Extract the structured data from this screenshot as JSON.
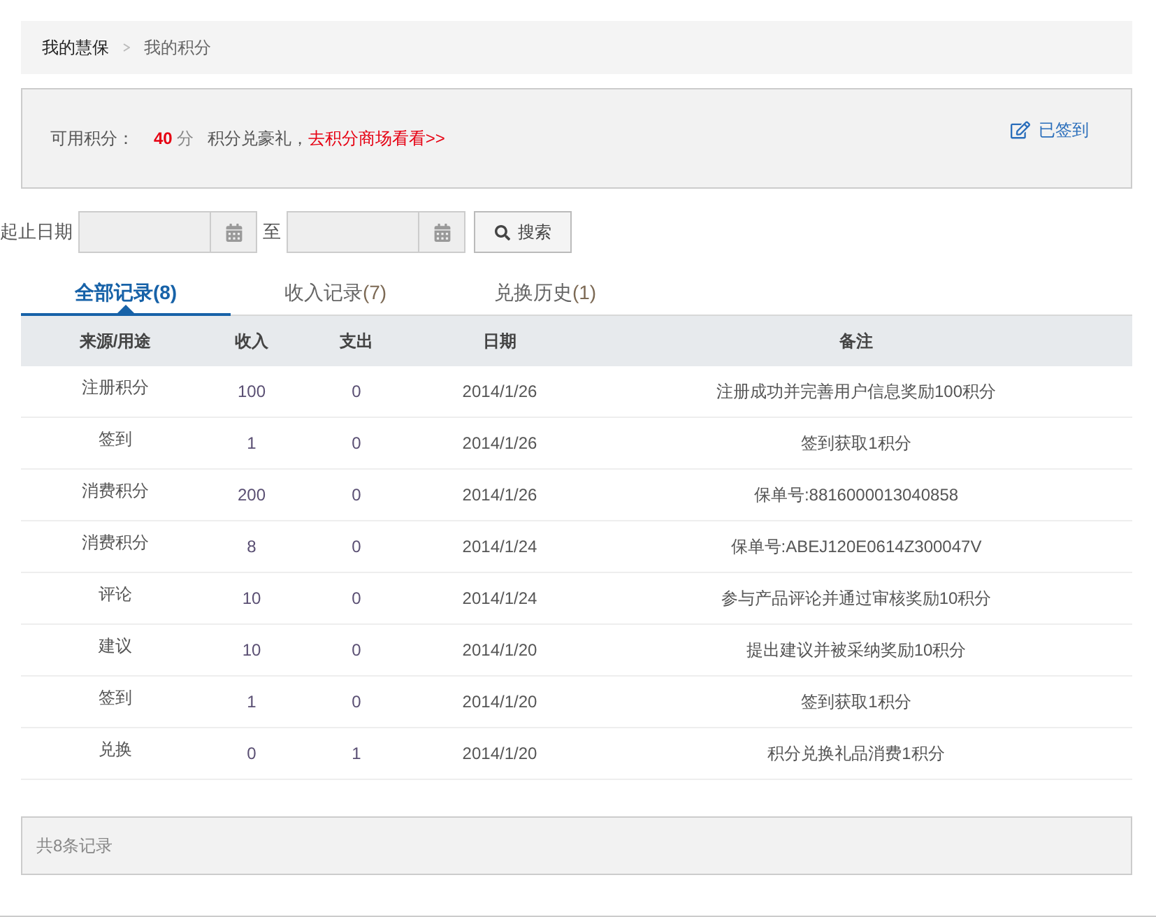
{
  "breadcrumb": [
    {
      "label": "我的慧保",
      "selected": false
    },
    {
      "label": "我的积分",
      "selected": true
    }
  ],
  "points": {
    "label": "可用积分：",
    "value": "40",
    "unit": "分",
    "promo": "积分兑豪礼，",
    "link": "去积分商场看看>>",
    "checkin": "已签到"
  },
  "filter": {
    "label": "起止日期",
    "separator": "至",
    "button": "搜索"
  },
  "tabs": [
    {
      "label": "全部记录",
      "count": "(8)",
      "selected": true
    },
    {
      "label": "收入记录",
      "count": "(7)",
      "selected": false
    },
    {
      "label": "兑换历史",
      "count": "(1)",
      "selected": false
    }
  ],
  "table": {
    "columns": [
      "来源/用途",
      "收入",
      "支出",
      "日期",
      "备注"
    ],
    "rows": [
      [
        "注册积分",
        "100",
        "0",
        "2014/1/26",
        "注册成功并完善用户信息奖励100积分"
      ],
      [
        "签到",
        "1",
        "0",
        "2014/1/26",
        "签到获取1积分"
      ],
      [
        "消费积分",
        "200",
        "0",
        "2014/1/26",
        "保单号:8816000013040858"
      ],
      [
        "消费积分",
        "8",
        "0",
        "2014/1/24",
        "保单号:ABEJ120E0614Z300047V"
      ],
      [
        "评论",
        "10",
        "0",
        "2014/1/24",
        "参与产品评论并通过审核奖励10积分"
      ],
      [
        "建议",
        "10",
        "0",
        "2014/1/20",
        "提出建议并被采纳奖励10积分"
      ],
      [
        "签到",
        "1",
        "0",
        "2014/1/20",
        "签到获取1积分"
      ],
      [
        "兑换",
        "0",
        "1",
        "2014/1/20",
        "积分兑换礼品消费1积分"
      ]
    ]
  },
  "status_bar": "共8条记录"
}
